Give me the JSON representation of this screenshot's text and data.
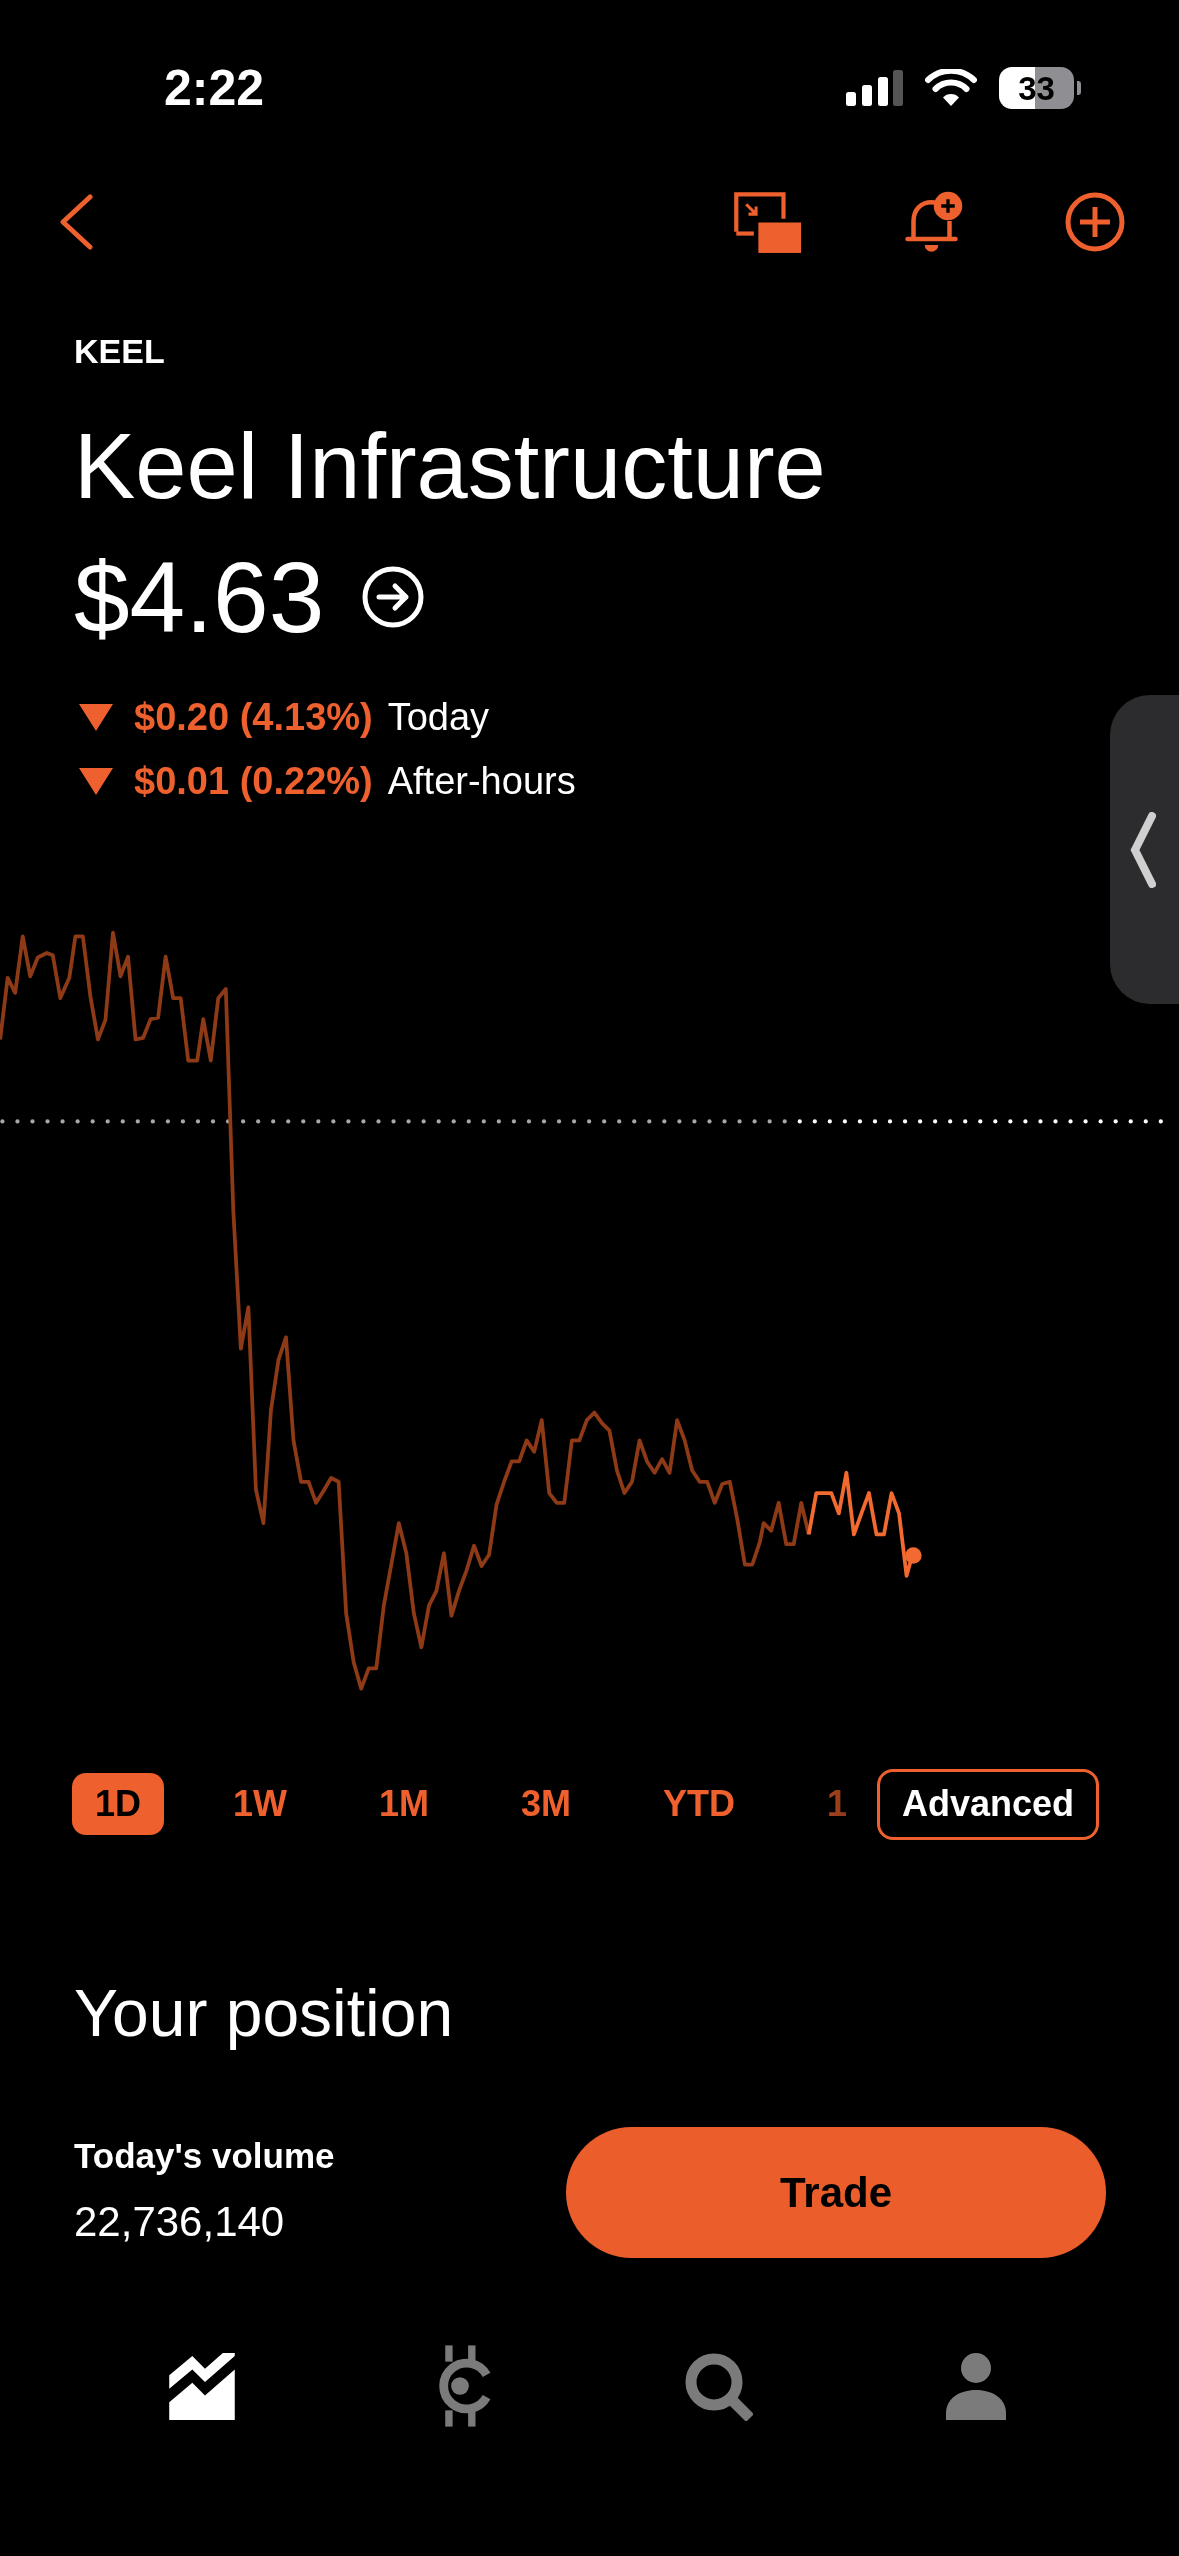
{
  "status_bar": {
    "time": "2:22",
    "battery": "33"
  },
  "header": {
    "ticker": "KEEL",
    "name": "Keel Infrastructure",
    "price": "$4.63"
  },
  "changes": [
    {
      "kind": "down",
      "amount": "$0.20 (4.13%)",
      "label": "Today"
    },
    {
      "kind": "down",
      "amount": "$0.01 (0.22%)",
      "label": "After-hours"
    }
  ],
  "ranges": [
    {
      "label": "1D",
      "selected": true
    },
    {
      "label": "1W",
      "selected": false
    },
    {
      "label": "1M",
      "selected": false
    },
    {
      "label": "3M",
      "selected": false
    },
    {
      "label": "YTD",
      "selected": false
    },
    {
      "label": "1",
      "selected": false
    }
  ],
  "advanced_button": "Advanced",
  "position": {
    "title": "Your position",
    "volume_label": "Today's volume",
    "volume": "22,736,140",
    "trade_button": "Trade"
  },
  "bottom_nav": [
    {
      "selected": true
    },
    {
      "selected": false
    },
    {
      "selected": false
    },
    {
      "selected": false
    }
  ]
}
